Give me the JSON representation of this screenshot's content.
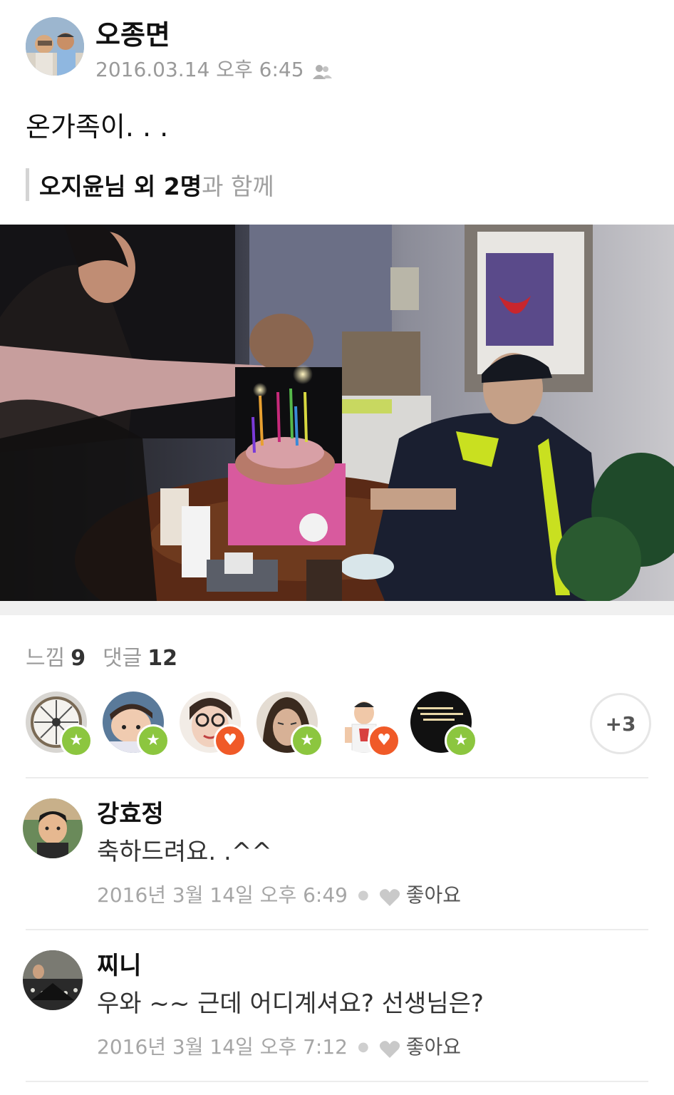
{
  "post": {
    "author": "오종면",
    "timestamp": "2016.03.14 오후 6:45",
    "privacy_icon": "friends-icon",
    "text": "온가족이. . .",
    "tagged_names": "오지윤님 외 2명",
    "tagged_suffix": "과 함께",
    "photo_icon": "birthday-photo"
  },
  "stats": {
    "feelings_label": "느낌",
    "feelings_count": "9",
    "comments_label": "댓글",
    "comments_count": "12"
  },
  "reactors": [
    {
      "avatar": "avatar-icon",
      "reaction": "star-icon"
    },
    {
      "avatar": "avatar-icon",
      "reaction": "star-icon"
    },
    {
      "avatar": "avatar-icon",
      "reaction": "heart-icon"
    },
    {
      "avatar": "avatar-icon",
      "reaction": "star-icon"
    },
    {
      "avatar": "avatar-icon",
      "reaction": "heart-icon"
    },
    {
      "avatar": "avatar-icon",
      "reaction": "star-icon"
    }
  ],
  "more_reactors": "+3",
  "comments": [
    {
      "name": "강효정",
      "text": "축하드려요. .^^",
      "time": "2016년 3월 14일 오후 6:49",
      "like_label": "좋아요"
    },
    {
      "name": "찌니",
      "text": "우와 ~~ 근데 어디계셔요? 선생님은?",
      "time": "2016년 3월 14일 오후 7:12",
      "like_label": "좋아요"
    }
  ],
  "colors": {
    "star_badge": "#8cc63f",
    "heart_badge": "#f05a28",
    "muted_text": "#9a9a9a"
  }
}
